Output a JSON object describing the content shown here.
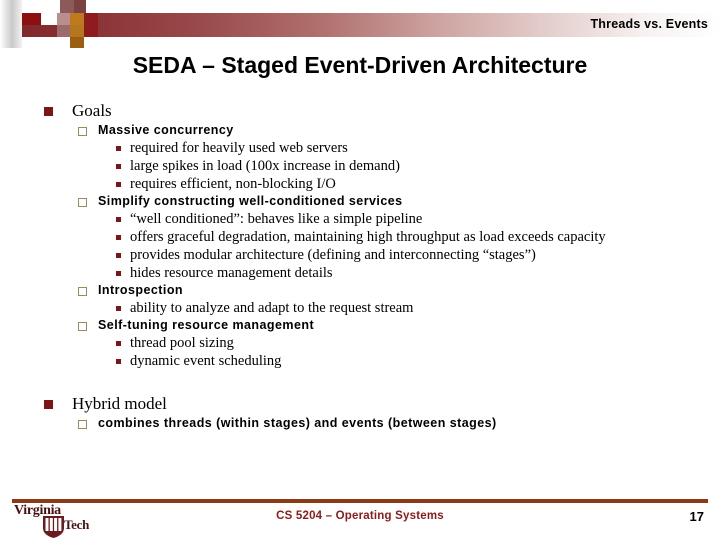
{
  "header": {
    "eyebrow_title": "Threads vs. Events",
    "accent_color": "#7d2427"
  },
  "slide": {
    "title": "SEDA – Staged Event-Driven Architecture"
  },
  "content": {
    "sections": [
      {
        "level1": "Goals",
        "level2_groups": [
          {
            "heading": "Massive concurrency",
            "items": [
              "required for heavily used web servers",
              "large spikes in load (100x increase in demand)",
              "requires efficient, non-blocking I/O"
            ]
          },
          {
            "heading": "Simplify constructing well-conditioned services",
            "items": [
              "“well conditioned”: behaves like a simple pipeline",
              "offers graceful degradation, maintaining high throughput as load exceeds capacity",
              "provides modular architecture (defining and interconnecting “stages”)",
              "hides resource management details"
            ]
          },
          {
            "heading": "Introspection",
            "items": [
              "ability to analyze and adapt to the request stream"
            ]
          },
          {
            "heading": "Self-tuning resource management",
            "items": [
              "thread pool sizing",
              "dynamic event scheduling"
            ]
          }
        ]
      },
      {
        "level1": "Hybrid model",
        "level2_groups": [
          {
            "heading": "combines threads (within stages) and events (between stages)",
            "items": []
          }
        ]
      }
    ]
  },
  "footer": {
    "course": "CS 5204 – Operating Systems",
    "page_number": "17",
    "logo_line1": "Virginia",
    "logo_line2": "Tech",
    "rule_color": "#8b3a18",
    "course_color": "#8b1a1a"
  }
}
